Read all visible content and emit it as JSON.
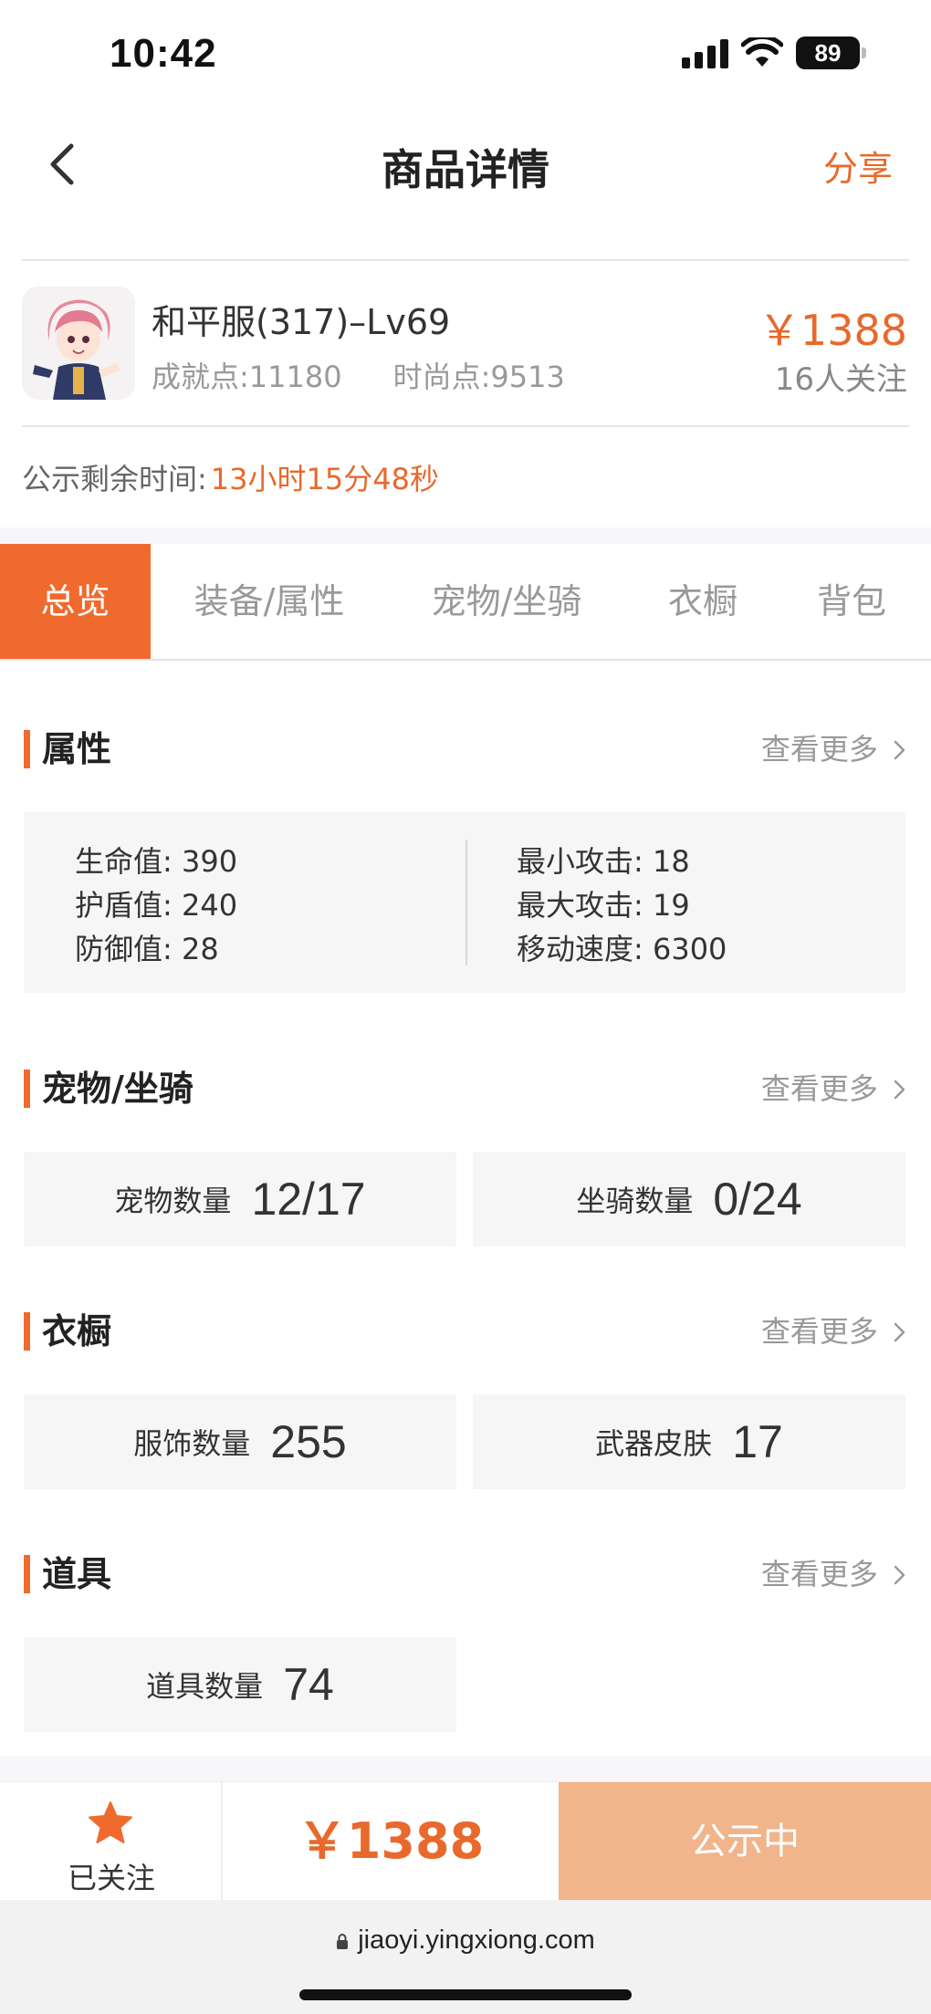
{
  "status_bar": {
    "time": "10:42",
    "battery": "89"
  },
  "header": {
    "title": "商品详情",
    "share_label": "分享"
  },
  "product": {
    "name": "和平服(317)–Lv69",
    "achievement": "成就点:11180",
    "fashion": "时尚点:9513",
    "price": "￥1388",
    "followers": "16人关注",
    "notice_label": "公示剩余时间:",
    "notice_countdown": "13小时15分48秒"
  },
  "tabs": [
    {
      "label": "总览",
      "active": true
    },
    {
      "label": "装备/属性"
    },
    {
      "label": "宠物/坐骑"
    },
    {
      "label": "衣橱"
    },
    {
      "label": "背包"
    }
  ],
  "sections": {
    "more_label": "查看更多",
    "attributes": {
      "title": "属性",
      "left": [
        {
          "label": "生命值:",
          "value": "390"
        },
        {
          "label": "护盾值:",
          "value": "240"
        },
        {
          "label": "防御值:",
          "value": "28"
        }
      ],
      "right": [
        {
          "label": "最小攻击:",
          "value": "18"
        },
        {
          "label": "最大攻击:",
          "value": "19"
        },
        {
          "label": "移动速度:",
          "value": "6300"
        }
      ]
    },
    "pets": {
      "title": "宠物/坐骑",
      "cards": [
        {
          "label": "宠物数量",
          "value": "12/17"
        },
        {
          "label": "坐骑数量",
          "value": "0/24"
        }
      ]
    },
    "wardrobe": {
      "title": "衣橱",
      "cards": [
        {
          "label": "服饰数量",
          "value": "255"
        },
        {
          "label": "武器皮肤",
          "value": "17"
        }
      ]
    },
    "items": {
      "title": "道具",
      "cards": [
        {
          "label": "道具数量",
          "value": "74"
        }
      ]
    }
  },
  "bottom_bar": {
    "follow_label": "已关注",
    "price": "￥1388",
    "status_label": "公示中"
  },
  "url_bar": {
    "url": "jiaoyi.yingxiong.com"
  },
  "colors": {
    "accent": "#f06a2d",
    "price": "#e8692c",
    "status_button": "#f2b48a"
  }
}
